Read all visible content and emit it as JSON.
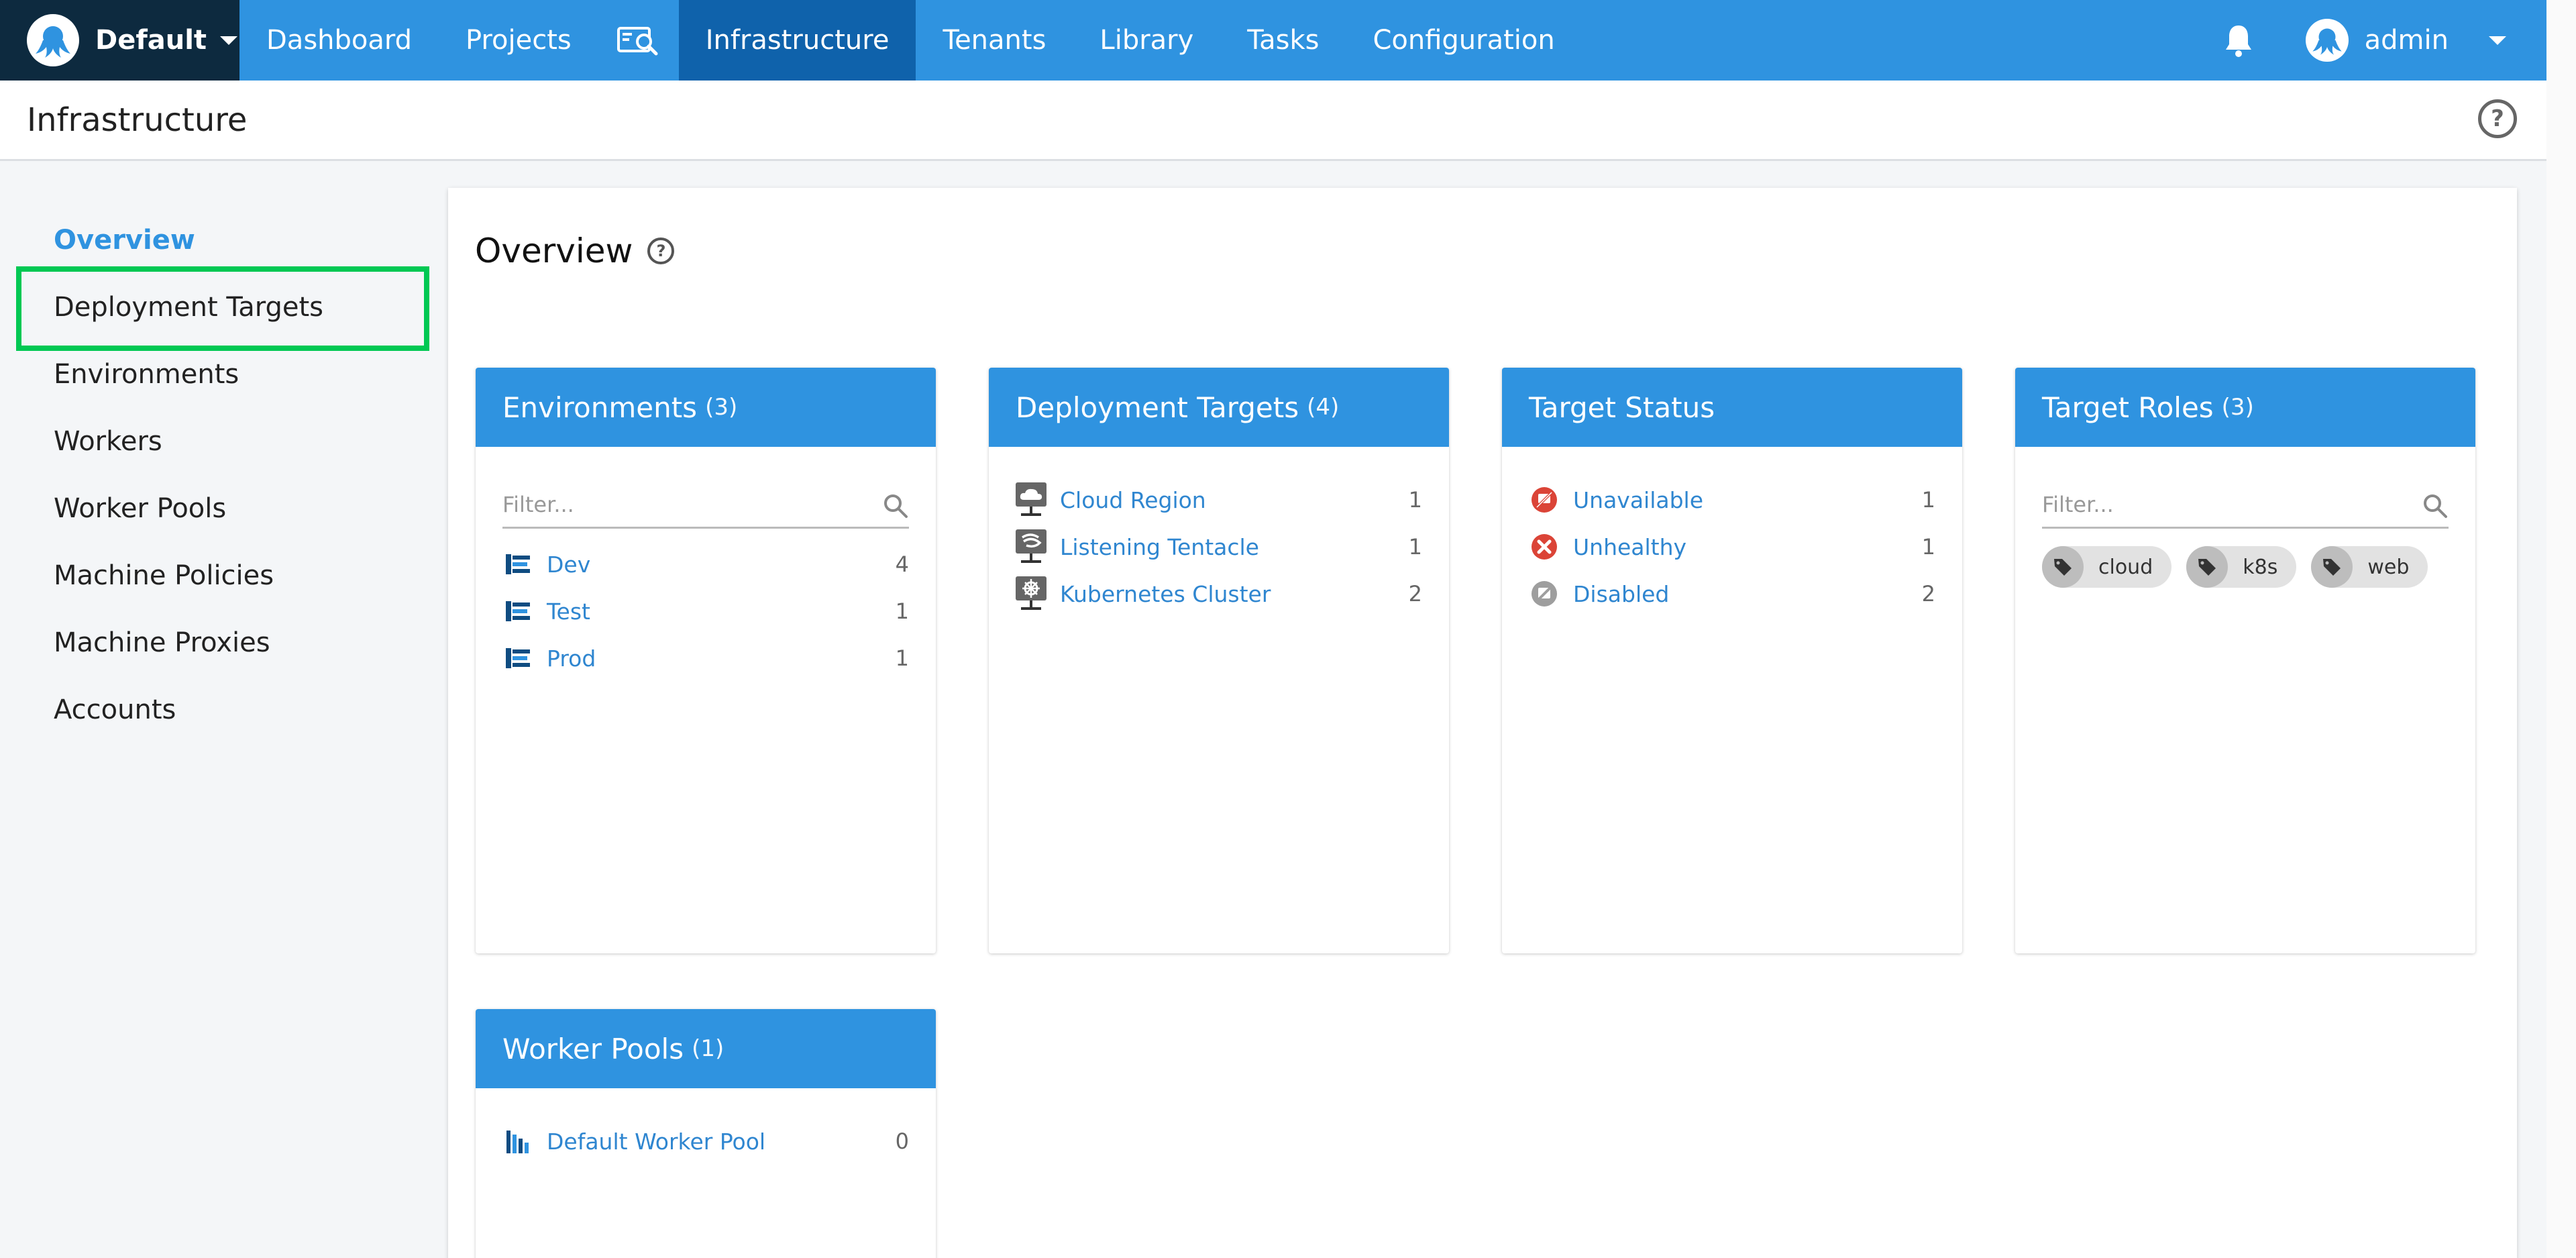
{
  "topnav": {
    "space_name": "Default",
    "items": [
      {
        "label": "Dashboard"
      },
      {
        "label": "Projects"
      },
      {
        "label": "Infrastructure",
        "active": true
      },
      {
        "label": "Tenants"
      },
      {
        "label": "Library"
      },
      {
        "label": "Tasks"
      },
      {
        "label": "Configuration"
      }
    ],
    "user_name": "admin"
  },
  "titlebar": {
    "title": "Infrastructure",
    "help": "?"
  },
  "sidebar": {
    "items": [
      {
        "label": "Overview",
        "active": true
      },
      {
        "label": "Deployment Targets",
        "highlighted": true
      },
      {
        "label": "Environments"
      },
      {
        "label": "Workers"
      },
      {
        "label": "Worker Pools"
      },
      {
        "label": "Machine Policies"
      },
      {
        "label": "Machine Proxies"
      },
      {
        "label": "Accounts"
      }
    ]
  },
  "overview": {
    "title": "Overview",
    "help": "?",
    "environments": {
      "title": "Environments",
      "count": "(3)",
      "filter_placeholder": "Filter...",
      "items": [
        {
          "name": "Dev",
          "count": "4"
        },
        {
          "name": "Test",
          "count": "1"
        },
        {
          "name": "Prod",
          "count": "1"
        }
      ]
    },
    "deployment_targets": {
      "title": "Deployment Targets",
      "count": "(4)",
      "items": [
        {
          "name": "Cloud Region",
          "count": "1",
          "icon": "cloud-region-icon"
        },
        {
          "name": "Listening Tentacle",
          "count": "1",
          "icon": "listening-tentacle-icon"
        },
        {
          "name": "Kubernetes Cluster",
          "count": "2",
          "icon": "kubernetes-icon"
        }
      ]
    },
    "target_status": {
      "title": "Target Status",
      "items": [
        {
          "name": "Unavailable",
          "count": "1",
          "icon": "unavailable-icon",
          "color": "#db4437"
        },
        {
          "name": "Unhealthy",
          "count": "1",
          "icon": "unhealthy-icon",
          "color": "#db4437"
        },
        {
          "name": "Disabled",
          "count": "2",
          "icon": "disabled-icon",
          "color": "#9e9e9e"
        }
      ]
    },
    "target_roles": {
      "title": "Target Roles",
      "count": "(3)",
      "filter_placeholder": "Filter...",
      "tags": [
        "cloud",
        "k8s",
        "web"
      ]
    },
    "worker_pools": {
      "title": "Worker Pools",
      "count": "(1)",
      "items": [
        {
          "name": "Default Worker Pool",
          "count": "0"
        }
      ]
    }
  },
  "colors": {
    "primary": "#2f93e0",
    "nav_active": "#0f62ab",
    "space_bg": "#0d2a3f",
    "highlight": "#00c853",
    "link": "#2f86d0"
  }
}
